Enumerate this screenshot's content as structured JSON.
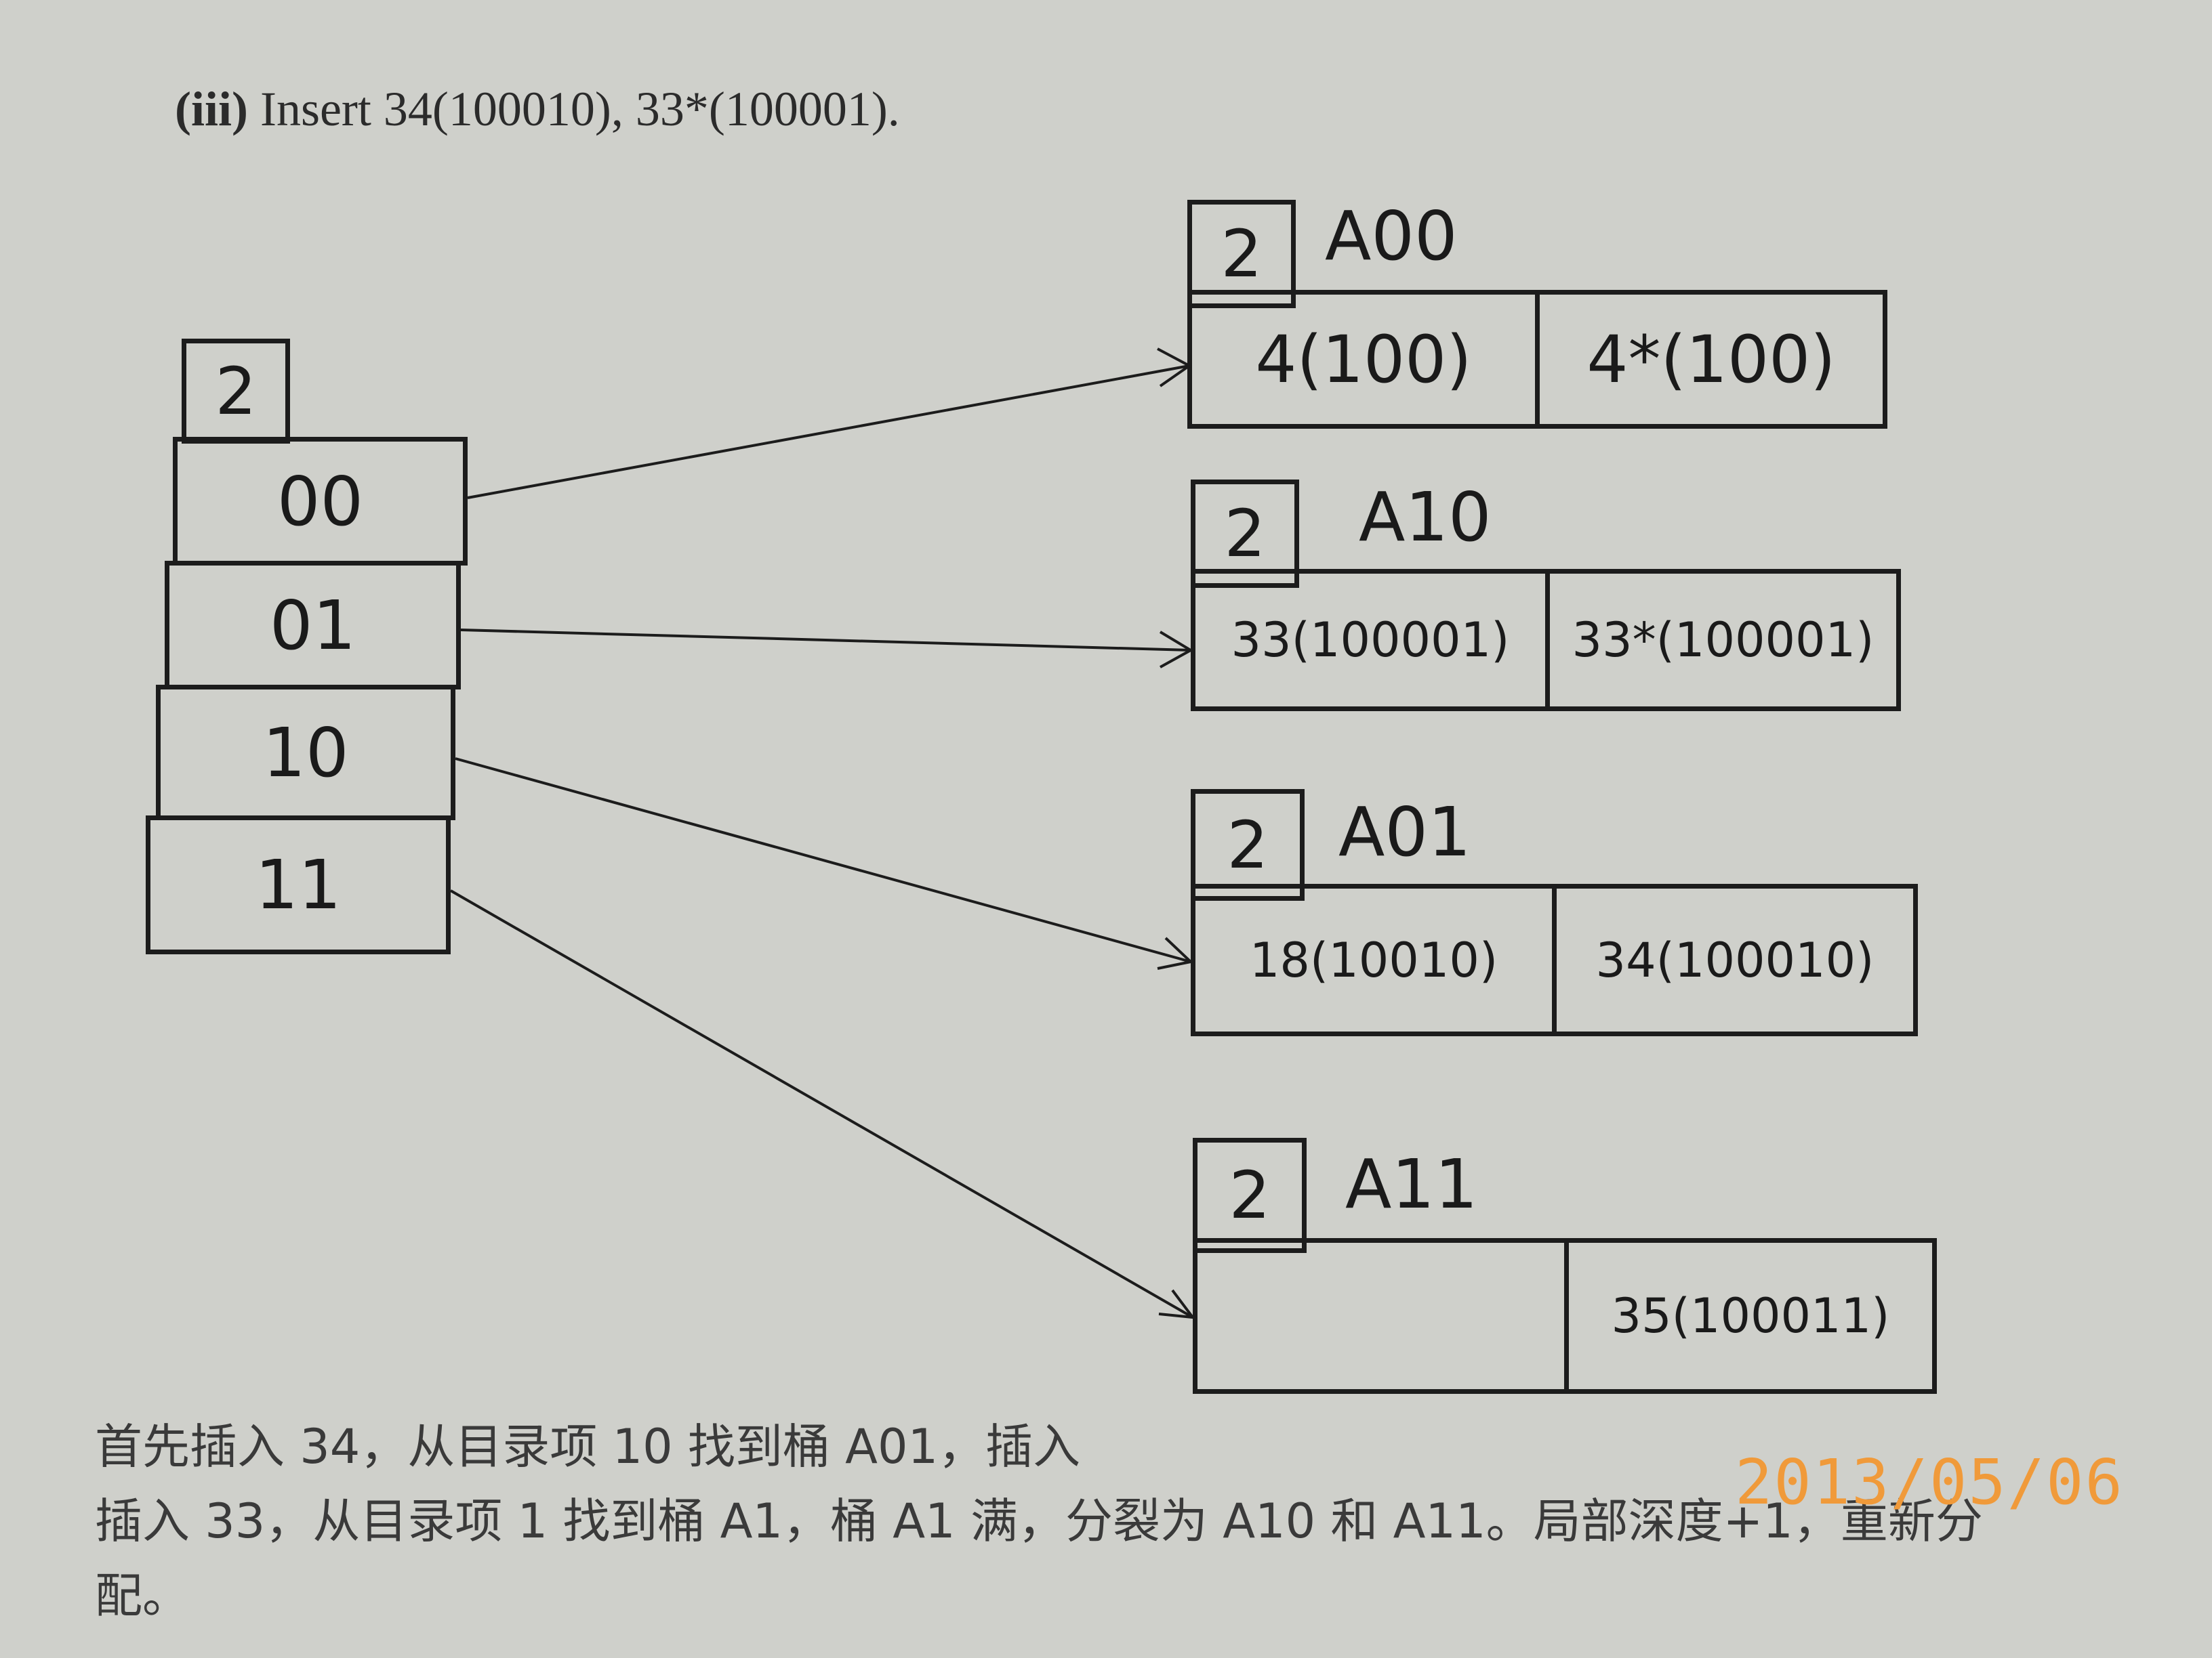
{
  "heading": {
    "label": "(iii)",
    "text": " Insert 34(100010), 33*(100001)."
  },
  "directory": {
    "depth": "2",
    "entries": [
      "00",
      "01",
      "10",
      "11"
    ]
  },
  "buckets": [
    {
      "name": "A00",
      "depth": "2",
      "slots": [
        "4(100)",
        "4*(100)"
      ]
    },
    {
      "name": "A10",
      "depth": "2",
      "slots": [
        "33(100001)",
        "33*(100001)"
      ]
    },
    {
      "name": "A01",
      "depth": "2",
      "slots": [
        "18(10010)",
        "34(100010)"
      ]
    },
    {
      "name": "A11",
      "depth": "2",
      "slots": [
        "",
        "35(100011)"
      ]
    }
  ],
  "notes": [
    "首先插入 34，从目录项 10 找到桶 A01，插入",
    "插入 33，从目录项 1 找到桶 A1，桶 A1 满，分裂为 A10 和 A11。局部深度+1，重新分",
    "配。"
  ],
  "photo_date_stamp": "2013/05/06",
  "colors": {
    "paper": "#cfd0cb",
    "ink": "#1c1c1c",
    "stamp": "#f09a3a"
  }
}
